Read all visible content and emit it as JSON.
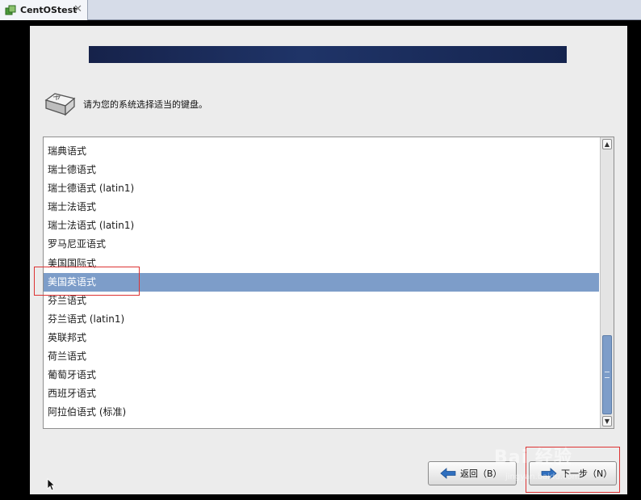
{
  "tab": {
    "title": "CentOStest",
    "close_glyph": "✕"
  },
  "installer": {
    "prompt": "请为您的系统选择适当的键盘。",
    "keyboard_list": [
      "瑞典语式",
      "瑞士德语式",
      "瑞士德语式 (latin1)",
      "瑞士法语式",
      "瑞士法语式 (latin1)",
      "罗马尼亚语式",
      "美国国际式",
      "美国英语式",
      "芬兰语式",
      "芬兰语式 (latin1)",
      "英联邦式",
      "荷兰语式",
      "葡萄牙语式",
      "西班牙语式",
      "阿拉伯语式 (标准)"
    ],
    "selected_index": 7,
    "back_button": "返回（B）",
    "next_button": "下一步（N）"
  },
  "watermark": {
    "text": "Bai 经验",
    "sub": "jingyan.baidu.com"
  },
  "colors": {
    "selection": "#7d9dc9",
    "banner": "#1f3468",
    "highlight_box": "#dd3333"
  }
}
